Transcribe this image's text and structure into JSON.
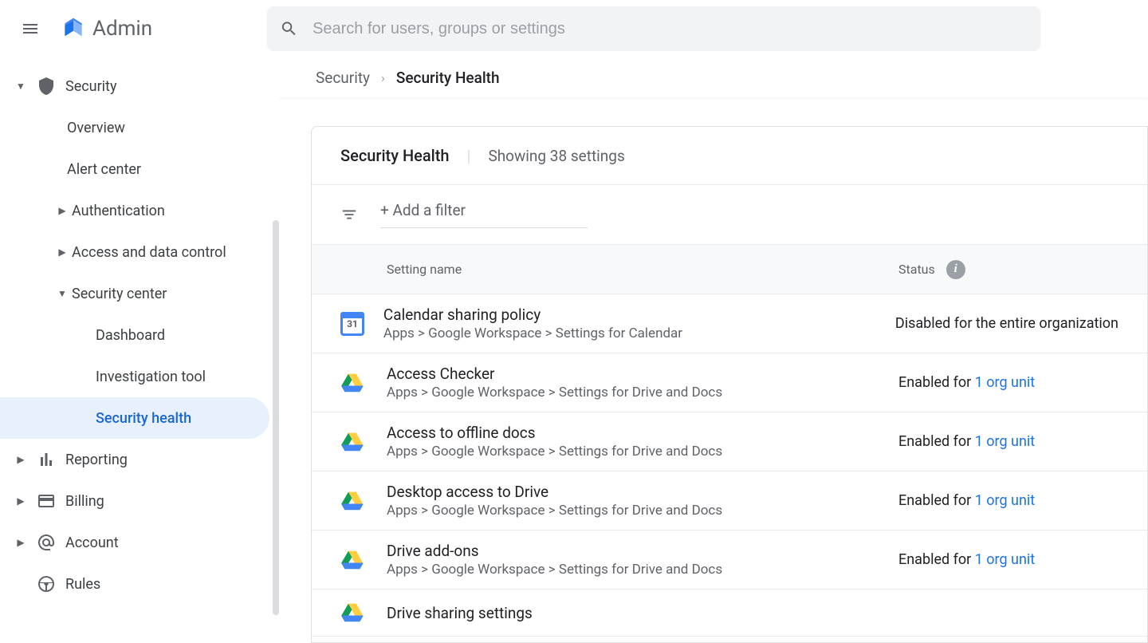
{
  "header": {
    "title": "Admin",
    "search_placeholder": "Search for users, groups or settings"
  },
  "sidebar": {
    "security": "Security",
    "overview": "Overview",
    "alert_center": "Alert center",
    "authentication": "Authentication",
    "access_data": "Access and data control",
    "security_center": "Security center",
    "dashboard": "Dashboard",
    "investigation_tool": "Investigation tool",
    "security_health": "Security health",
    "reporting": "Reporting",
    "billing": "Billing",
    "account": "Account",
    "rules": "Rules"
  },
  "breadcrumb": {
    "parent": "Security",
    "current": "Security Health"
  },
  "card": {
    "title": "Security Health",
    "subtitle": "Showing 38 settings",
    "add_filter": "+ Add a filter"
  },
  "table": {
    "col_name": "Setting name",
    "col_status": "Status"
  },
  "rows": [
    {
      "icon": "calendar",
      "name": "Calendar sharing policy",
      "path": "Apps > Google Workspace > Settings for Calendar",
      "status_prefix": "Disabled for the entire organization",
      "status_link": ""
    },
    {
      "icon": "drive",
      "name": "Access Checker",
      "path": "Apps > Google Workspace > Settings for Drive and Docs",
      "status_prefix": "Enabled for ",
      "status_link": "1 org unit"
    },
    {
      "icon": "drive",
      "name": "Access to offline docs",
      "path": "Apps > Google Workspace > Settings for Drive and Docs",
      "status_prefix": "Enabled for ",
      "status_link": "1 org unit"
    },
    {
      "icon": "drive",
      "name": "Desktop access to Drive",
      "path": "Apps > Google Workspace > Settings for Drive and Docs",
      "status_prefix": "Enabled for ",
      "status_link": "1 org unit"
    },
    {
      "icon": "drive",
      "name": "Drive add-ons",
      "path": "Apps > Google Workspace > Settings for Drive and Docs",
      "status_prefix": "Enabled for ",
      "status_link": "1 org unit"
    },
    {
      "icon": "drive",
      "name": "Drive sharing settings",
      "path": "",
      "status_prefix": "",
      "status_link": ""
    }
  ]
}
